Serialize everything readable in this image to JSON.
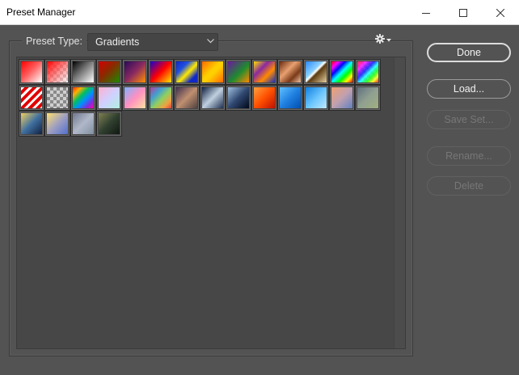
{
  "window": {
    "title": "Preset Manager"
  },
  "preset_type": {
    "label": "Preset Type:",
    "selected": "Gradients"
  },
  "buttons": {
    "done": "Done",
    "load": "Load...",
    "save_set": "Save Set...",
    "rename": "Rename...",
    "delete": "Delete"
  },
  "colors": {
    "dialog_bg": "#535353",
    "panel_bg": "#474747",
    "title_bg": "#ffffff"
  },
  "icons": {
    "minimize": "minimize-icon",
    "maximize": "maximize-icon",
    "close": "close-icon",
    "dropdown": "chevron-down-icon",
    "panel_menu": "gear-icon"
  },
  "gradients": [
    {
      "name": "foreground-to-background",
      "css": "linear-gradient(135deg,#ff0000 0%,#ff5a5a 45%,#ffffff 100%)"
    },
    {
      "name": "foreground-to-transparent",
      "css": "linear-gradient(135deg,#ff0000 0%,rgba(255,60,60,0.55) 55%,rgba(255,255,255,0) 100%),repeating-conic-gradient(#cfcfcf 0% 25%,#ffffff 0% 50%) 0 0/8px 8px"
    },
    {
      "name": "black-white",
      "css": "linear-gradient(135deg,#000000 0%,#777777 45%,#ffffff 100%)"
    },
    {
      "name": "red-green",
      "css": "linear-gradient(135deg,#d40000 0%,#8a2a00 45%,#1c8a00 100%)"
    },
    {
      "name": "violet-orange",
      "css": "linear-gradient(135deg,#2a0a5a 0%,#8a2a60 50%,#ff9000 100%)"
    },
    {
      "name": "blue-red-yellow",
      "css": "linear-gradient(135deg,#1a00d0 0%,#ff0000 50%,#ffe800 100%)"
    },
    {
      "name": "blue-yellow-blue",
      "css": "linear-gradient(135deg,#1028c8 0%,#2050e0 30%,#ffe800 55%,#1028c8 80%)"
    },
    {
      "name": "orange-yellow-orange",
      "css": "linear-gradient(135deg,#ff6a00 0%,#ffd000 45%,#ffd000 55%,#ff6a00 100%)"
    },
    {
      "name": "violet-green-orange",
      "css": "linear-gradient(135deg,#6a1a9a 0%,#1e8a30 55%,#ff8a00 100%)"
    },
    {
      "name": "yellow-violet-orange-blue",
      "css": "linear-gradient(135deg,#ffe000 0%,#8a2aa0 35%,#ff8a00 65%,#1830c0 100%)"
    },
    {
      "name": "copper",
      "css": "linear-gradient(135deg,#6a2a10 0%,#e8a070 40%,#7a3a18 70%,#f0c0a0 100%)"
    },
    {
      "name": "chrome",
      "css": "linear-gradient(135deg,#2a88ff 0%,#8ad0ff 40%,#ffffff 48%,#5a3a10 55%,#e8d0a0 100%)"
    },
    {
      "name": "spectrum",
      "css": "linear-gradient(135deg,#ff0000 0%,#ff00ff 17%,#0000ff 33%,#00ffff 50%,#00ff00 67%,#ffff00 83%,#ff0000 100%)"
    },
    {
      "name": "transparent-rainbow",
      "css": "linear-gradient(135deg,rgba(255,0,0,0.8) 0%,rgba(255,0,255,0.8) 20%,rgba(0,0,255,0.8) 40%,rgba(0,255,255,0.8) 55%,rgba(0,255,0,0.8) 70%,rgba(255,255,0,0.8) 85%,rgba(255,0,0,0.8) 100%),repeating-conic-gradient(#cfcfcf 0% 25%,#ffffff 0% 50%) 0 0/8px 8px"
    },
    {
      "name": "transparent-stripes",
      "css": "repeating-linear-gradient(135deg,#ffffff 0px,#ffffff 3px,#e00000 3px,#e00000 7px)"
    },
    {
      "name": "transparent-checker",
      "css": "repeating-conic-gradient(#8a8a8a 0% 25%,#cfcfcf 0% 50%) 0 0/8px 8px"
    },
    {
      "name": "rainbow-stripes",
      "css": "linear-gradient(135deg,#ff2a00 0%,#ffb000 20%,#00c060 40%,#0090ff 60%,#7a30e0 80%,#ff00a0 100%)"
    },
    {
      "name": "pastel-1",
      "css": "linear-gradient(135deg,#ffb0d0 0%,#d0d0ff 50%,#b0f0e0 100%)"
    },
    {
      "name": "pastel-2",
      "css": "linear-gradient(135deg,#80b0ff 0%,#ff90c0 50%,#ffe0a0 100%)"
    },
    {
      "name": "pastel-rainbow",
      "css": "linear-gradient(135deg,#b040a0 0%,#40a0d0 30%,#90d060 55%,#f0a040 80%,#e04040 100%)"
    },
    {
      "name": "brown-grey",
      "css": "linear-gradient(135deg,#403050 0%,#c09070 50%,#504040 100%)"
    },
    {
      "name": "steel",
      "css": "linear-gradient(135deg,#102040 0%,#c0d0e0 50%,#203050 100%)"
    },
    {
      "name": "night",
      "css": "linear-gradient(135deg,#a0c0e0 0%,#304870 50%,#000818 100%)"
    },
    {
      "name": "fire",
      "css": "linear-gradient(135deg,#ffa040 0%,#ff5000 50%,#c01000 100%)"
    },
    {
      "name": "blue-sky",
      "css": "linear-gradient(135deg,#60c0ff 0%,#2080e0 50%,#0050b0 100%)"
    },
    {
      "name": "light-blue",
      "css": "linear-gradient(135deg,#1080e0 0%,#70c8ff 55%,#c0e8ff 100%)"
    },
    {
      "name": "peach-blue",
      "css": "linear-gradient(135deg,#f0a070 0%,#c0a0b0 50%,#6080c0 100%)"
    },
    {
      "name": "sage",
      "css": "linear-gradient(135deg,#607080 0%,#90a090 50%,#a0b080 100%)"
    },
    {
      "name": "gold-navy",
      "css": "linear-gradient(135deg,#f0d060 0%,#4070a0 50%,#102040 100%)"
    },
    {
      "name": "gold-violet",
      "css": "linear-gradient(135deg,#ffe070 0%,#a0a0c0 50%,#5070d0 100%)"
    },
    {
      "name": "silver",
      "css": "linear-gradient(135deg,#707890 0%,#b0b8c8 50%,#8090a0 100%)"
    },
    {
      "name": "dark-olive",
      "css": "linear-gradient(135deg,#808050 0%,#304030 50%,#101810 100%)"
    }
  ]
}
